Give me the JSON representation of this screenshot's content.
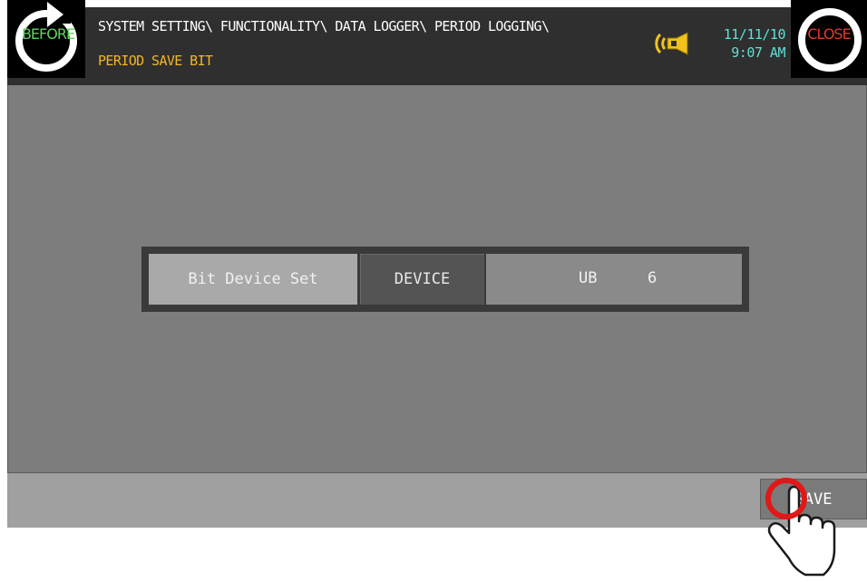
{
  "header": {
    "before_label": "BEFORE",
    "path_line1": "SYSTEM SETTING\\ FUNCTIONALITY\\ DATA LOGGER\\ PERIOD LOGGING\\",
    "path_line2": "PERIOD SAVE BIT",
    "date": "11/11/10",
    "time": "9:07 AM",
    "close_label": "CLOSE",
    "speaker_icon": "speaker-icon"
  },
  "device_setting": {
    "label": "Bit Device Set",
    "device_button": "DEVICE",
    "device_name": "UB",
    "device_number": "6"
  },
  "footer": {
    "save_label": "SAVE"
  },
  "colors": {
    "header_bg": "#2f2f2f",
    "screen_bg": "#7d7d7d",
    "path_highlight": "#f2b625",
    "datetime": "#5fe0d8",
    "before": "#5ed25e",
    "close": "#e23b2f"
  }
}
